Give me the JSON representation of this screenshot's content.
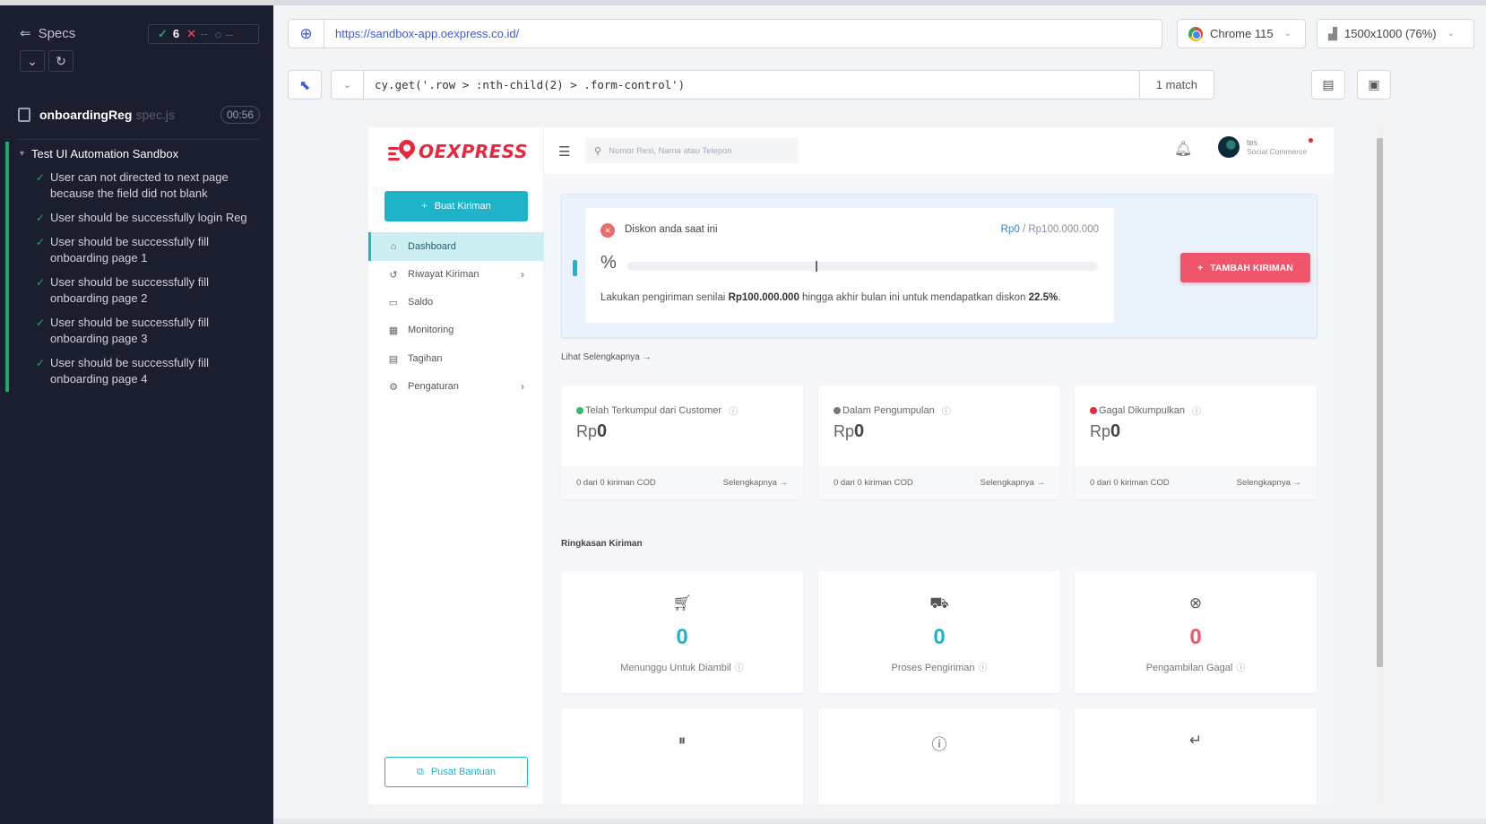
{
  "runner": {
    "specs_label": "Specs",
    "passed": "6",
    "failed": "--",
    "pending": "--",
    "spec_file": "onboardingReg",
    "spec_ext": "spec.js",
    "duration": "00:56",
    "suite": "Test UI Automation Sandbox",
    "tests": [
      "User can not directed to next page because the field did not blank",
      "User should be successfully login Reg",
      "User should be successfully fill onboarding page 1",
      "User should be successfully fill onboarding page 2",
      "User should be successfully fill onboarding page 3",
      "User should be successfully fill onboarding page 4"
    ]
  },
  "browser": {
    "url": "https://sandbox-app.oexpress.co.id/",
    "browser_name": "Chrome 115",
    "viewport": "1500x1000 (76%)",
    "selector_code": "cy.get('.row > :nth-child(2) > .form-control')",
    "match_count": "1 match"
  },
  "app": {
    "logo_text": "OEXPRESS",
    "create_button": "Buat Kiriman",
    "nav": [
      {
        "label": "Dashboard",
        "icon": "home-icon",
        "active": true
      },
      {
        "label": "Riwayat Kiriman",
        "icon": "history-icon",
        "chevron": true
      },
      {
        "label": "Saldo",
        "icon": "wallet-icon"
      },
      {
        "label": "Monitoring",
        "icon": "calendar-icon"
      },
      {
        "label": "Tagihan",
        "icon": "card-icon"
      },
      {
        "label": "Pengaturan",
        "icon": "gear-icon",
        "chevron": true
      }
    ],
    "help_button": "Pusat Bantuan",
    "search_placeholder": "Nomor Resi, Nama atau Telepon",
    "user_name": "tes",
    "user_role": "Social Commerce",
    "discount": {
      "label": "Diskon anda saat ini",
      "current": "Rp0",
      "target": "/ Rp100.000.000",
      "percent_symbol": "%",
      "progress_fraction": 0,
      "note_prefix": "Lakukan pengiriman senilai ",
      "note_amount": "Rp100.000.000",
      "note_mid": " hingga akhir bulan ini untuk mendapatkan diskon ",
      "note_pct": "22.5%",
      "note_suffix": "."
    },
    "add_button": "TAMBAH KIRIMAN",
    "see_more": "Lihat Selengkapnya",
    "summary_cards": [
      {
        "title": "Telah Terkumpul dari Customer",
        "currency": "Rp",
        "value": "0",
        "footer": "0 dari 0 kiriman COD",
        "more": "Selengkapnya",
        "dot_color": "#2ebd6b"
      },
      {
        "title": "Dalam Pengumpulan",
        "currency": "Rp",
        "value": "0",
        "footer": "0 dari 0 kiriman COD",
        "more": "Selengkapnya",
        "dot_color": "#777777"
      },
      {
        "title": "Gagal Dikumpulkan",
        "currency": "Rp",
        "value": "0",
        "footer": "0 dari 0 kiriman COD",
        "more": "Selengkapnya",
        "dot_color": "#e8273f"
      }
    ],
    "ringkasan_title": "Ringkasan Kiriman",
    "status_cards": [
      {
        "label": "Menunggu Untuk Diambil",
        "value": "0",
        "icon": "cart-icon"
      },
      {
        "label": "Proses Pengiriman",
        "value": "0",
        "icon": "truck-icon"
      },
      {
        "label": "Pengambilan Gagal",
        "value": "0",
        "icon": "x-circle-icon"
      },
      {
        "label": "",
        "value": "",
        "icon": "pause-circle-icon"
      },
      {
        "label": "",
        "value": "",
        "icon": "alert-circle-icon"
      },
      {
        "label": "",
        "value": "",
        "icon": "return-icon"
      }
    ]
  },
  "colors": {
    "accent": "#1fb3c9",
    "brand_red": "#e8273f",
    "runner_bg": "#1b1e2e",
    "pass_green": "#1fa971"
  }
}
